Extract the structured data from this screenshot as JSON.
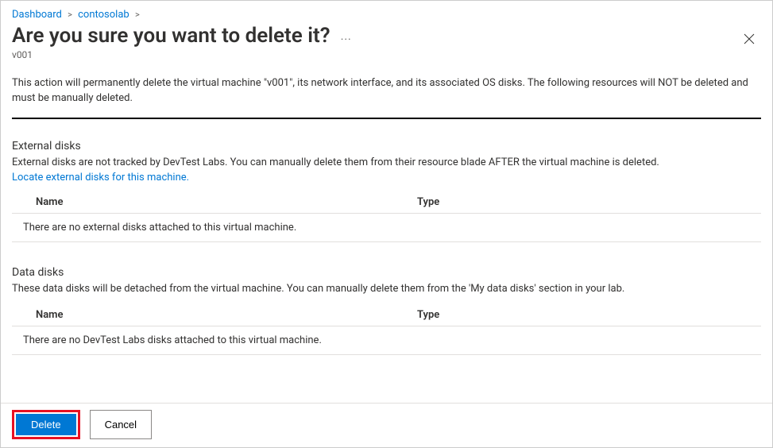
{
  "breadcrumb": {
    "dashboard": "Dashboard",
    "lab": "contosolab"
  },
  "header": {
    "title": "Are you sure you want to delete it?",
    "subtitle": "v001"
  },
  "warning_text": "This action will permanently delete the virtual machine \"v001\", its network interface, and its associated OS disks. The following resources will NOT be deleted and must be manually deleted.",
  "external_disks": {
    "title": "External disks",
    "desc": "External disks are not tracked by DevTest Labs. You can manually delete them from their resource blade AFTER the virtual machine is deleted.",
    "locate_link": "Locate external disks for this machine.",
    "col_name": "Name",
    "col_type": "Type",
    "empty": "There are no external disks attached to this virtual machine."
  },
  "data_disks": {
    "title": "Data disks",
    "desc": "These data disks will be detached from the virtual machine. You can manually delete them from the 'My data disks' section in your lab.",
    "col_name": "Name",
    "col_type": "Type",
    "empty": "There are no DevTest Labs disks attached to this virtual machine."
  },
  "footer": {
    "delete": "Delete",
    "cancel": "Cancel"
  }
}
